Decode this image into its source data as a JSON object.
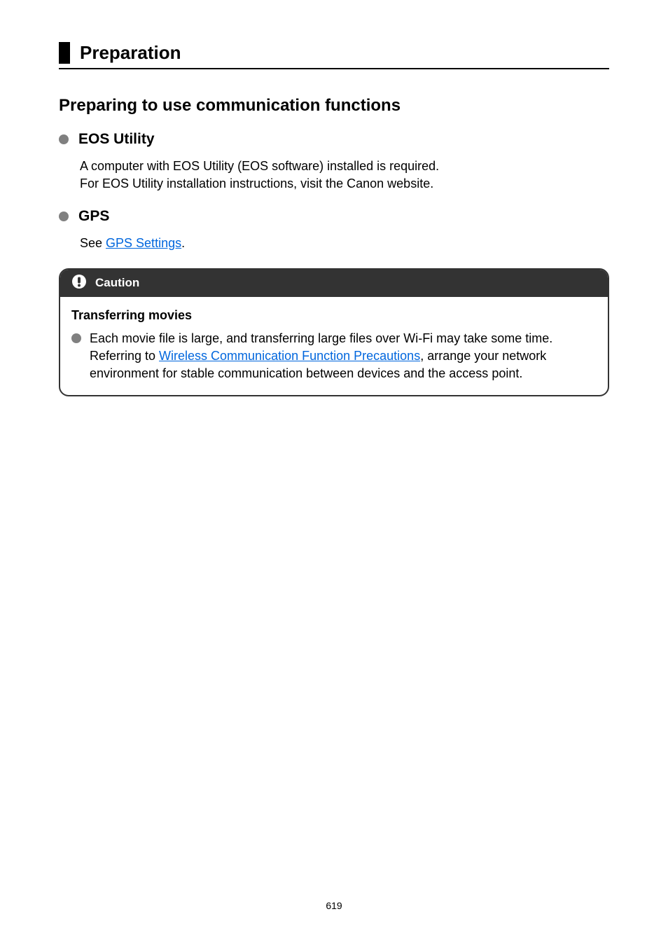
{
  "page_title": "Preparation",
  "section_heading": "Preparing to use communication functions",
  "items": [
    {
      "label": "EOS Utility",
      "body_lines": [
        "A computer with EOS Utility (EOS software) installed is required.",
        "For EOS Utility installation instructions, visit the Canon website."
      ]
    },
    {
      "label": "GPS",
      "body_prefix": "See ",
      "body_link": "GPS Settings",
      "body_suffix": "."
    }
  ],
  "caution": {
    "label": "Caution",
    "subheading": "Transferring movies",
    "text_prefix": "Each movie file is large, and transferring large files over Wi-Fi may take some time. Referring to ",
    "text_link": "Wireless Communication Function Precautions",
    "text_suffix": ", arrange your network environment for stable communication between devices and the access point."
  },
  "page_number": "619"
}
